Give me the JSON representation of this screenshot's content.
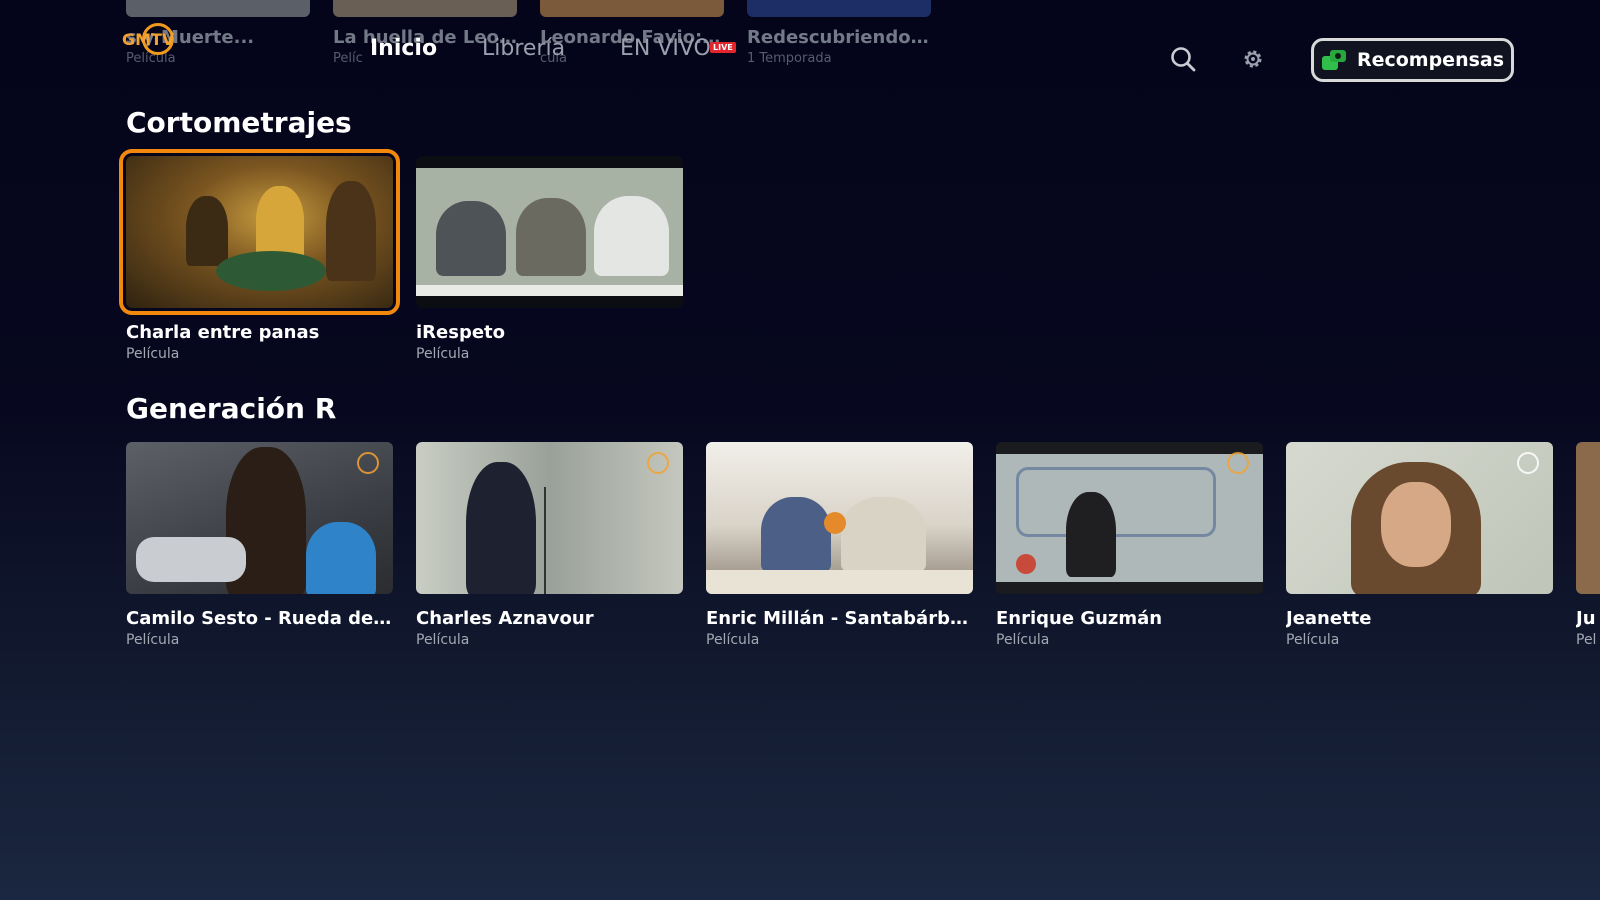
{
  "top_row": [
    {
      "title": "s y Muerte...",
      "sub": "Película",
      "color": "#5b5f68"
    },
    {
      "title": "La huella de Leo...",
      "sub": "Pelíc",
      "color": "#6a5f55"
    },
    {
      "title": "Leonardo Favio: ...",
      "sub": "cula",
      "color": "#7a5a3a"
    },
    {
      "title": "Redescubriendo ...",
      "sub": "1 Temporada",
      "color": "#1d2d66"
    }
  ],
  "header": {
    "logo_text": "GMTV",
    "nav": {
      "inicio": "Inicio",
      "libreria": "Librería",
      "envivo": "EN VIVO",
      "live_badge": "LIVE"
    },
    "rewards_label": "Recompensas",
    "search_icon": "search-icon",
    "settings_icon": "gear-icon"
  },
  "sections": [
    {
      "title": "Cortometrajes",
      "items": [
        {
          "title": "Charla entre panas",
          "sub": "Película",
          "focused": true
        },
        {
          "title": "iRespeto",
          "sub": "Película"
        }
      ]
    },
    {
      "title": "Generación R",
      "items": [
        {
          "title": "Camilo Sesto - Rueda de ...",
          "sub": "Película"
        },
        {
          "title": "Charles Aznavour",
          "sub": "Película"
        },
        {
          "title": "Enric Millán - Santabárbara",
          "sub": "Película"
        },
        {
          "title": "Enrique Guzmán",
          "sub": "Película"
        },
        {
          "title": "Jeanette",
          "sub": "Película"
        },
        {
          "title": "Ju",
          "sub": "Pel"
        }
      ]
    }
  ],
  "colors": {
    "accent_focus": "#f2880c",
    "rewards_green": "#2fbf4a",
    "live_red": "#e3262e"
  }
}
